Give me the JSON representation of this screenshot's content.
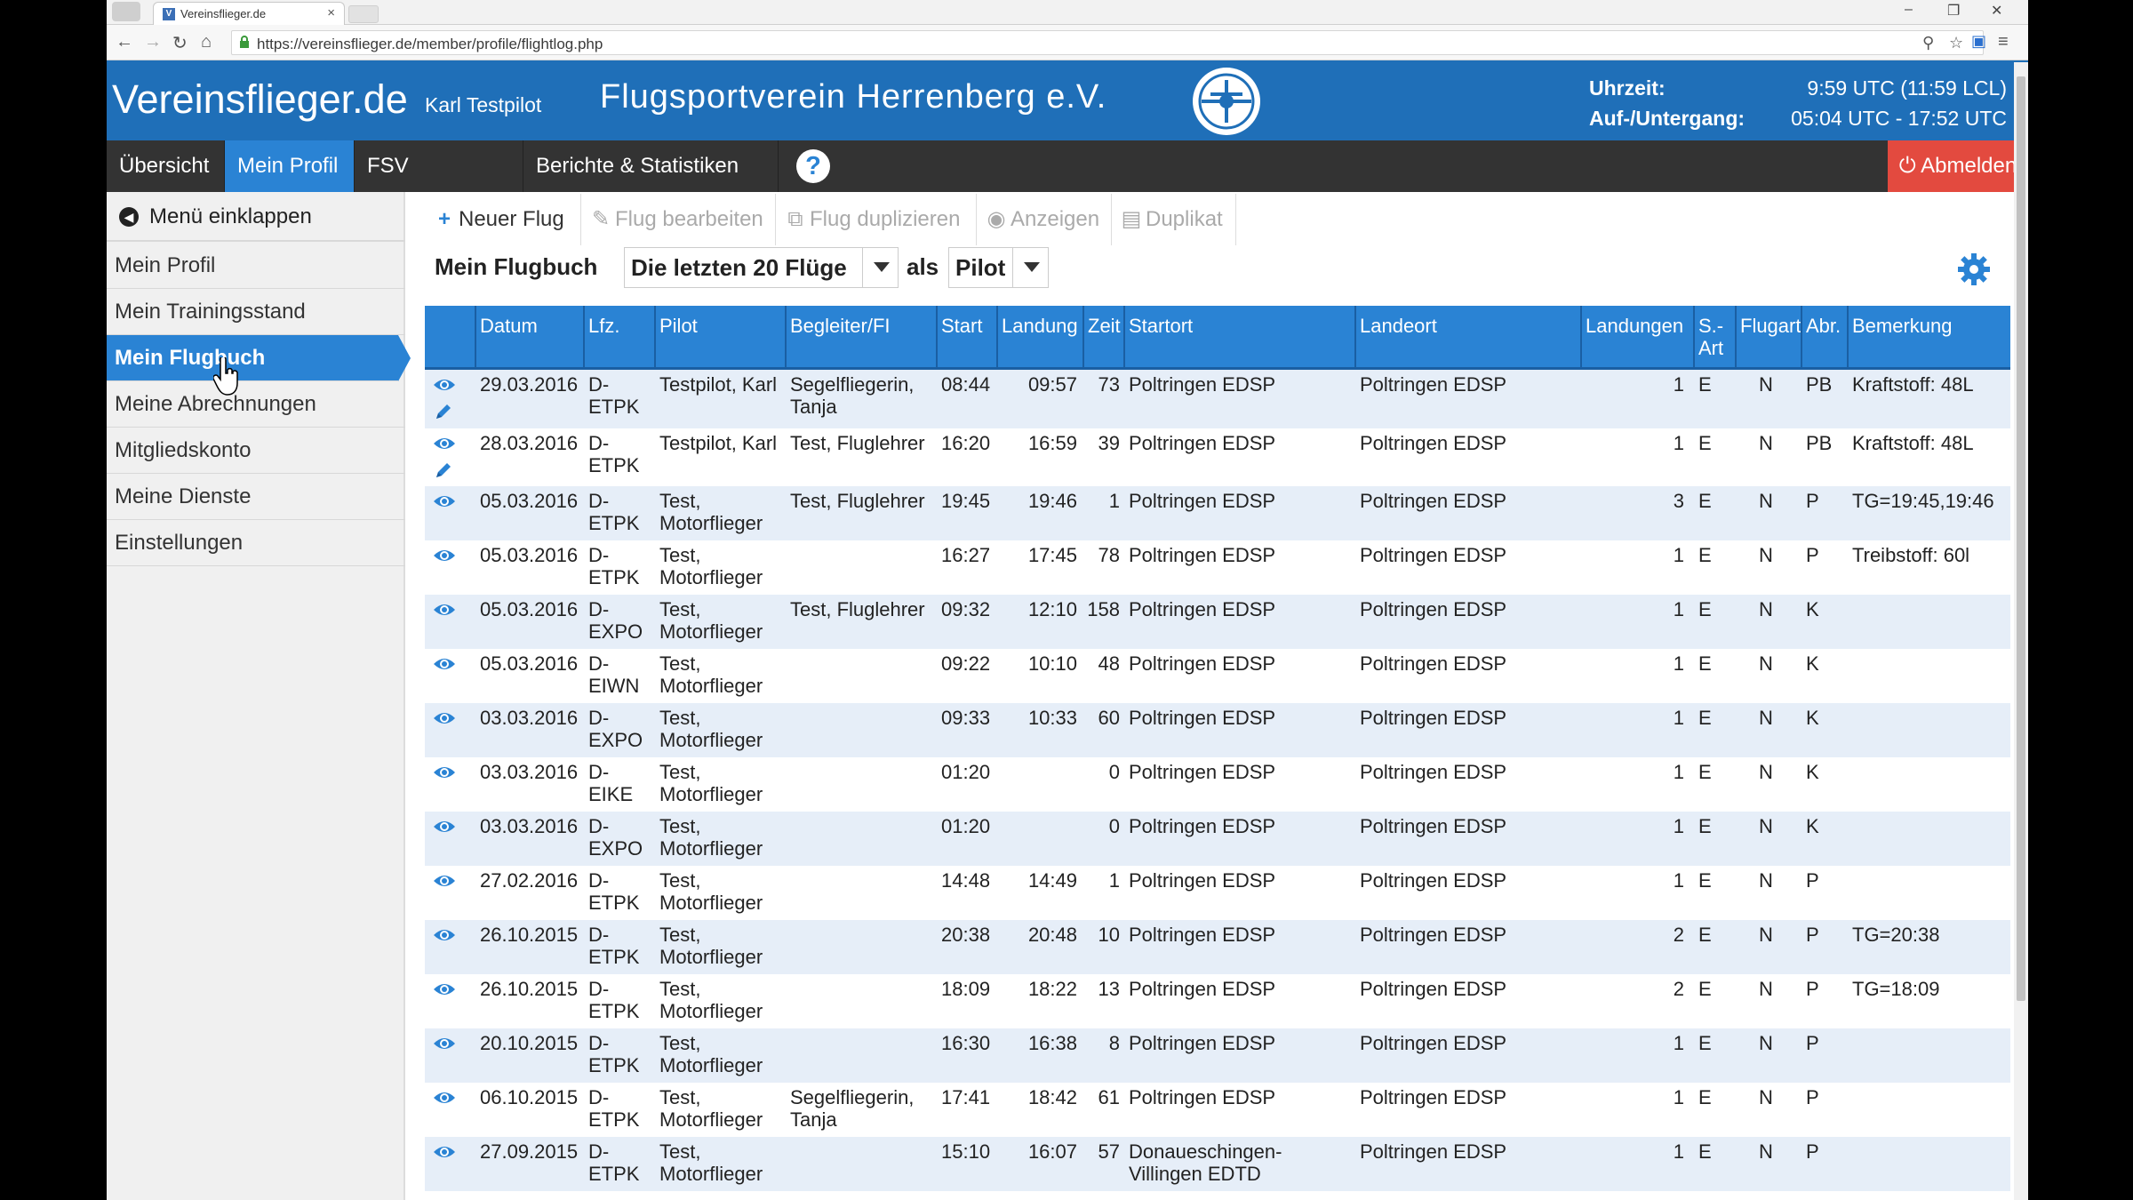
{
  "browser": {
    "tab_title": "Vereinsflieger.de",
    "tab_favicon": "V",
    "url": "https://vereinsflieger.de/member/profile/flightlog.php"
  },
  "header": {
    "brand": "Vereinsflieger.de",
    "user": "Karl Testpilot",
    "club": "Flugsportverein Herrenberg e.V.",
    "time_label": "Uhrzeit:",
    "time_value": "9:59 UTC (11:59 LCL)",
    "sun_label": "Auf-/Untergang:",
    "sun_value": "05:04 UTC - 17:52 UTC"
  },
  "nav": {
    "items": [
      "Übersicht",
      "Mein Profil",
      "FSV Herrenberg",
      "Berichte & Statistiken"
    ],
    "help": "?",
    "logout": "Abmelden"
  },
  "sidebar": {
    "collapse": "Menü einklappen",
    "items": [
      "Mein Profil",
      "Mein Trainingsstand",
      "Mein Flugbuch",
      "Meine Abrechnungen",
      "Mitgliedskonto",
      "Meine Dienste",
      "Einstellungen"
    ]
  },
  "toolbar": {
    "new": "Neuer Flug",
    "edit": "Flug bearbeiten",
    "duplicate": "Flug duplizieren",
    "show": "Anzeigen",
    "copy": "Duplikat"
  },
  "flugbuch": {
    "title": "Mein Flugbuch",
    "filter": "Die letzten 20 Flüge",
    "als": "als",
    "role": "Pilot"
  },
  "table": {
    "columns": [
      "Datum",
      "Lfz.",
      "Pilot",
      "Begleiter/FI",
      "Start",
      "Landung",
      "Zeit",
      "Startort",
      "Landeort",
      "Landungen",
      "S.-\nArt",
      "Flugart",
      "Abr.",
      "Bemerkung"
    ],
    "rows": [
      {
        "datum": "29.03.2016",
        "lfz": "D-\nETPK",
        "pilot": "Testpilot, Karl",
        "begleiter": "Segelfliegerin,\nTanja",
        "start": "08:44",
        "landung": "09:57",
        "zeit": "73",
        "startort": "Poltringen EDSP",
        "landeort": "Poltringen EDSP",
        "landungen": "1",
        "sart": "E",
        "flugart": "N",
        "abr": "PB",
        "bemerkung": "Kraftstoff: 48L",
        "editable": true
      },
      {
        "datum": "28.03.2016",
        "lfz": "D-\nETPK",
        "pilot": "Testpilot, Karl",
        "begleiter": "Test, Fluglehrer",
        "start": "16:20",
        "landung": "16:59",
        "zeit": "39",
        "startort": "Poltringen EDSP",
        "landeort": "Poltringen EDSP",
        "landungen": "1",
        "sart": "E",
        "flugart": "N",
        "abr": "PB",
        "bemerkung": "Kraftstoff: 48L",
        "editable": true
      },
      {
        "datum": "05.03.2016",
        "lfz": "D-\nETPK",
        "pilot": "Test,\nMotorflieger",
        "begleiter": "Test, Fluglehrer",
        "start": "19:45",
        "landung": "19:46",
        "zeit": "1",
        "startort": "Poltringen EDSP",
        "landeort": "Poltringen EDSP",
        "landungen": "3",
        "sart": "E",
        "flugart": "N",
        "abr": "P",
        "bemerkung": "TG=19:45,19:46",
        "editable": false
      },
      {
        "datum": "05.03.2016",
        "lfz": "D-\nETPK",
        "pilot": "Test,\nMotorflieger",
        "begleiter": "",
        "start": "16:27",
        "landung": "17:45",
        "zeit": "78",
        "startort": "Poltringen EDSP",
        "landeort": "Poltringen EDSP",
        "landungen": "1",
        "sart": "E",
        "flugart": "N",
        "abr": "P",
        "bemerkung": "Treibstoff: 60l",
        "editable": false
      },
      {
        "datum": "05.03.2016",
        "lfz": "D-\nEXPO",
        "pilot": "Test,\nMotorflieger",
        "begleiter": "Test, Fluglehrer",
        "start": "09:32",
        "landung": "12:10",
        "zeit": "158",
        "startort": "Poltringen EDSP",
        "landeort": "Poltringen EDSP",
        "landungen": "1",
        "sart": "E",
        "flugart": "N",
        "abr": "K",
        "bemerkung": "",
        "editable": false
      },
      {
        "datum": "05.03.2016",
        "lfz": "D-\nEIWN",
        "pilot": "Test,\nMotorflieger",
        "begleiter": "",
        "start": "09:22",
        "landung": "10:10",
        "zeit": "48",
        "startort": "Poltringen EDSP",
        "landeort": "Poltringen EDSP",
        "landungen": "1",
        "sart": "E",
        "flugart": "N",
        "abr": "K",
        "bemerkung": "",
        "editable": false
      },
      {
        "datum": "03.03.2016",
        "lfz": "D-\nEXPO",
        "pilot": "Test,\nMotorflieger",
        "begleiter": "",
        "start": "09:33",
        "landung": "10:33",
        "zeit": "60",
        "startort": "Poltringen EDSP",
        "landeort": "Poltringen EDSP",
        "landungen": "1",
        "sart": "E",
        "flugart": "N",
        "abr": "K",
        "bemerkung": "",
        "editable": false
      },
      {
        "datum": "03.03.2016",
        "lfz": "D-\nEIKE",
        "pilot": "Test,\nMotorflieger",
        "begleiter": "",
        "start": "01:20",
        "landung": "",
        "zeit": "0",
        "startort": "Poltringen EDSP",
        "landeort": "Poltringen EDSP",
        "landungen": "1",
        "sart": "E",
        "flugart": "N",
        "abr": "K",
        "bemerkung": "",
        "editable": false
      },
      {
        "datum": "03.03.2016",
        "lfz": "D-\nEXPO",
        "pilot": "Test,\nMotorflieger",
        "begleiter": "",
        "start": "01:20",
        "landung": "",
        "zeit": "0",
        "startort": "Poltringen EDSP",
        "landeort": "Poltringen EDSP",
        "landungen": "1",
        "sart": "E",
        "flugart": "N",
        "abr": "K",
        "bemerkung": "",
        "editable": false
      },
      {
        "datum": "27.02.2016",
        "lfz": "D-\nETPK",
        "pilot": "Test,\nMotorflieger",
        "begleiter": "",
        "start": "14:48",
        "landung": "14:49",
        "zeit": "1",
        "startort": "Poltringen EDSP",
        "landeort": "Poltringen EDSP",
        "landungen": "1",
        "sart": "E",
        "flugart": "N",
        "abr": "P",
        "bemerkung": "",
        "editable": false
      },
      {
        "datum": "26.10.2015",
        "lfz": "D-\nETPK",
        "pilot": "Test,\nMotorflieger",
        "begleiter": "",
        "start": "20:38",
        "landung": "20:48",
        "zeit": "10",
        "startort": "Poltringen EDSP",
        "landeort": "Poltringen EDSP",
        "landungen": "2",
        "sart": "E",
        "flugart": "N",
        "abr": "P",
        "bemerkung": "TG=20:38",
        "editable": false
      },
      {
        "datum": "26.10.2015",
        "lfz": "D-\nETPK",
        "pilot": "Test,\nMotorflieger",
        "begleiter": "",
        "start": "18:09",
        "landung": "18:22",
        "zeit": "13",
        "startort": "Poltringen EDSP",
        "landeort": "Poltringen EDSP",
        "landungen": "2",
        "sart": "E",
        "flugart": "N",
        "abr": "P",
        "bemerkung": "TG=18:09",
        "editable": false
      },
      {
        "datum": "20.10.2015",
        "lfz": "D-\nETPK",
        "pilot": "Test,\nMotorflieger",
        "begleiter": "",
        "start": "16:30",
        "landung": "16:38",
        "zeit": "8",
        "startort": "Poltringen EDSP",
        "landeort": "Poltringen EDSP",
        "landungen": "1",
        "sart": "E",
        "flugart": "N",
        "abr": "P",
        "bemerkung": "",
        "editable": false
      },
      {
        "datum": "06.10.2015",
        "lfz": "D-\nETPK",
        "pilot": "Test,\nMotorflieger",
        "begleiter": "Segelfliegerin,\nTanja",
        "start": "17:41",
        "landung": "18:42",
        "zeit": "61",
        "startort": "Poltringen EDSP",
        "landeort": "Poltringen EDSP",
        "landungen": "1",
        "sart": "E",
        "flugart": "N",
        "abr": "P",
        "bemerkung": "",
        "editable": false
      },
      {
        "datum": "27.09.2015",
        "lfz": "D-\nETPK",
        "pilot": "Test,\nMotorflieger",
        "begleiter": "",
        "start": "15:10",
        "landung": "16:07",
        "zeit": "57",
        "startort": "Donaueschingen-\nVillingen EDTD",
        "landeort": "Poltringen EDSP",
        "landungen": "1",
        "sart": "E",
        "flugart": "N",
        "abr": "P",
        "bemerkung": "",
        "editable": false
      }
    ]
  },
  "colors": {
    "header_blue": "#1f6fb8",
    "accent_blue": "#2a83d4",
    "nav_dark": "#333333",
    "logout_red": "#e34a3f",
    "row_stripe": "#e6eef8"
  }
}
